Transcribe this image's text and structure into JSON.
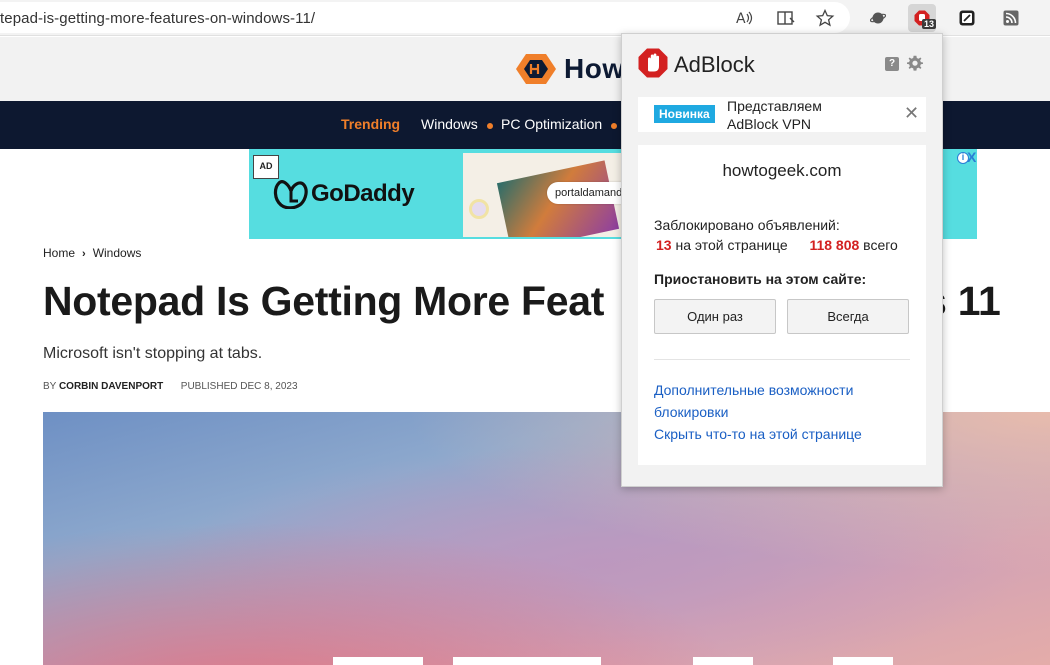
{
  "browser": {
    "url": "tepad-is-getting-more-features-on-windows-11/",
    "extension_badge": "13",
    "icons": [
      "read-aloud-icon",
      "immersive-reader-icon",
      "favorite-star-icon",
      "extension-planet-icon",
      "adblock-extension-icon",
      "extension-square-icon",
      "rss-icon"
    ]
  },
  "site": {
    "logo_text": "How-",
    "nav": {
      "trending": "Trending",
      "items": [
        "Windows",
        "PC Optimization"
      ]
    }
  },
  "ad": {
    "badge": "AD",
    "brand": "GoDaddy",
    "pill_text": "portaldamandala",
    "info": "i",
    "close": "X"
  },
  "article": {
    "breadcrumb": [
      "Home",
      "Windows"
    ],
    "breadcrumb_sep": "›",
    "title_left": "Notepad Is Getting More Feat",
    "title_right": "s 11",
    "subtitle": "Microsoft isn't stopping at tabs.",
    "by_label": "BY",
    "author": "CORBIN DAVENPORT",
    "published": "PUBLISHED DEC 8, 2023"
  },
  "adblock": {
    "title": "AdBlock",
    "help": "?",
    "promo": {
      "tag": "Новинка",
      "text": "Представляем AdBlock VPN",
      "close": "✕"
    },
    "domain": "howtogeek.com",
    "blocked_label": "Заблокировано объявлений:",
    "page_count": "13",
    "page_suffix": "на этой странице",
    "total_count": "118 808",
    "total_suffix": "всего",
    "pause_label": "Приостановить на этом сайте:",
    "buttons": {
      "once": "Один раз",
      "always": "Всегда"
    },
    "links": {
      "more_line1": "Дополнительные возможности",
      "more_line2": "блокировки",
      "hide": "Скрыть что-то на этой странице"
    }
  },
  "colors": {
    "nav_bg": "#0d1830",
    "accent_orange": "#f07f2a",
    "adblock_red": "#d32121",
    "link_blue": "#1a5fc4",
    "promo_blue": "#1fa9e1",
    "ad_bg": "#56dde0"
  }
}
